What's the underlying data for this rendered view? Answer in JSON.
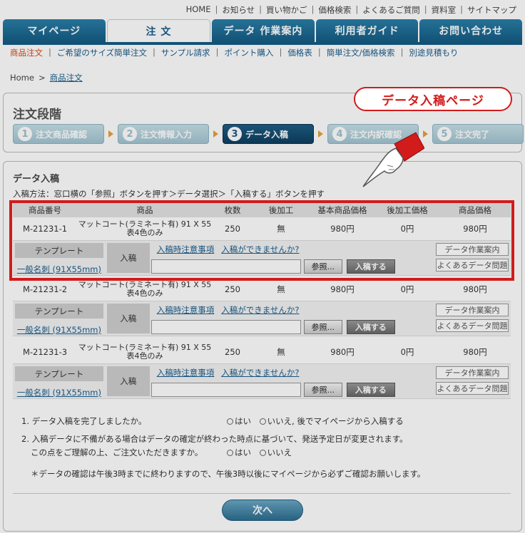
{
  "util_nav": [
    "HOME",
    "お知らせ",
    "買い物かご",
    "価格検索",
    "よくあるご質問",
    "資料室",
    "サイトマップ"
  ],
  "tabs": [
    "マイページ",
    "注 文",
    "データ 作業案内",
    "利用者ガイド",
    "お問い合わせ"
  ],
  "subnav": [
    "商品注文",
    "ご希望のサイズ簡単注文",
    "サンプル請求",
    "ポイント購入",
    "価格表",
    "簡単注文/価格検索",
    "別途見積もり"
  ],
  "breadcrumb": {
    "home": "Home",
    "current": "商品注文",
    "arrow": ">"
  },
  "steps_title": "注文段階",
  "steps": [
    {
      "num": "1",
      "label": "注文商品確認"
    },
    {
      "num": "2",
      "label": "注文情報入力"
    },
    {
      "num": "3",
      "label": "データ入稿"
    },
    {
      "num": "4",
      "label": "注文内訳確認"
    },
    {
      "num": "5",
      "label": "注文完了"
    }
  ],
  "callout": "データ入稿ページ",
  "data_title": "データ入稿",
  "howto": "入稿方法：窓口横の「参照」ボタンを押す＞データ選択＞「入稿する」ボタンを押す",
  "table_headers": [
    "商品番号",
    "商品",
    "枚数",
    "後加工",
    "基本商品価格",
    "後加工価格",
    "商品価格"
  ],
  "orders": [
    {
      "code": "M-21231-1",
      "product1": "マットコート(ラミネート有) 91 X 55",
      "product2": "表4色のみ",
      "qty": "250",
      "post": "無",
      "base": "980円",
      "post_price": "0円",
      "price": "980円",
      "template_label": "テンプレート",
      "template_link": "一般名刺 (91X55mm)",
      "upload_label": "入稿",
      "link1": "入稿時注意事項",
      "link2": "入稿ができませんか?",
      "browse": "参照...",
      "submit": "入稿する",
      "btn1": "データ作業案内",
      "btn2": "よくあるデータ問題"
    },
    {
      "code": "M-21231-2",
      "product1": "マットコート(ラミネート有) 91 X 55",
      "product2": "表4色のみ",
      "qty": "250",
      "post": "無",
      "base": "980円",
      "post_price": "0円",
      "price": "980円",
      "template_label": "テンプレート",
      "template_link": "一般名刺 (91X55mm)",
      "upload_label": "入稿",
      "link1": "入稿時注意事項",
      "link2": "入稿ができませんか?",
      "browse": "参照...",
      "submit": "入稿する",
      "btn1": "データ作業案内",
      "btn2": "よくあるデータ問題"
    },
    {
      "code": "M-21231-3",
      "product1": "マットコート(ラミネート有) 91 X 55",
      "product2": "表4色のみ",
      "qty": "250",
      "post": "無",
      "base": "980円",
      "post_price": "0円",
      "price": "980円",
      "template_label": "テンプレート",
      "template_link": "一般名刺 (91X55mm)",
      "upload_label": "入稿",
      "link1": "入稿時注意事項",
      "link2": "入稿ができませんか?",
      "browse": "参照...",
      "submit": "入稿する",
      "btn1": "データ作業案内",
      "btn2": "よくあるデータ問題"
    }
  ],
  "questions": {
    "q1": "1. データ入稿を完了しましたか。",
    "q1_yes": "はい",
    "q1_no": "いいえ, 後でマイページから入稿する",
    "q2_line1": "2. 入稿データに不備がある場合はデータの確定が終わった時点に基づいて、発送予定日が変更されます。",
    "q2_line2": "この点をご理解の上、ご注文いただきますか。",
    "q2_yes": "はい",
    "q2_no": "いいえ",
    "note": "＊データの確認は午後3時までに終わりますので、午後3時以後にマイページから必ずご確認お願いします。"
  },
  "next_button": "次へ",
  "colors": {
    "accent": "#155c84",
    "highlight": "#d21b1b"
  }
}
